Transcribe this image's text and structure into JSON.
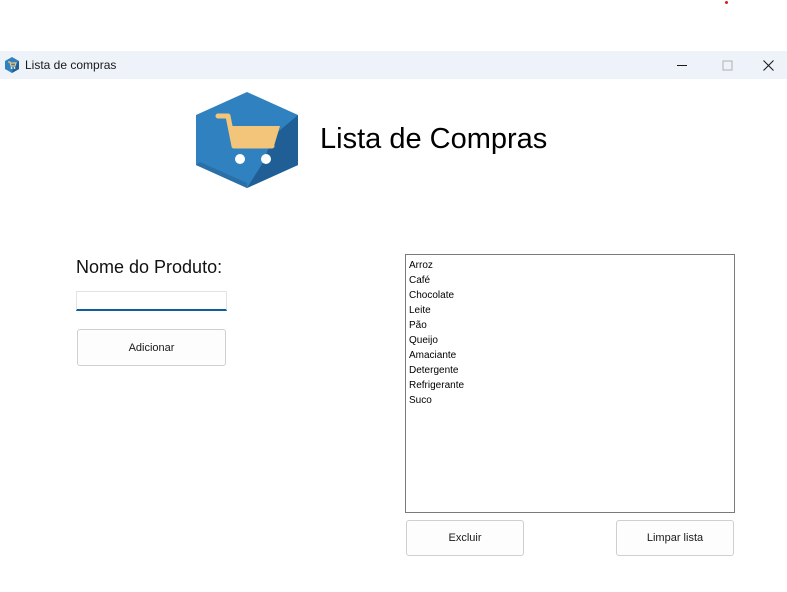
{
  "window": {
    "title": "Lista de compras",
    "controls": [
      "minimize",
      "maximize",
      "close"
    ]
  },
  "header": {
    "logo_icon": "shopping-cart-hexagon-icon",
    "title": "Lista de Compras"
  },
  "form": {
    "product_label": "Nome do Produto:",
    "product_value": "",
    "add_button": "Adicionar"
  },
  "list": {
    "items": [
      "Arroz",
      "Café",
      "Chocolate",
      "Leite",
      "Pão",
      "Queijo",
      "Amaciante",
      "Detergente",
      "Refrigerante",
      "Suco"
    ],
    "delete_button": "Excluir",
    "clear_button": "Limpar lista"
  },
  "colors": {
    "accent": "#0f5e9c",
    "logo_blue": "#2f82bf",
    "logo_dark": "#1f5f96",
    "cart_orange": "#f2c57a",
    "titlebar_bg": "#eef3fa"
  }
}
